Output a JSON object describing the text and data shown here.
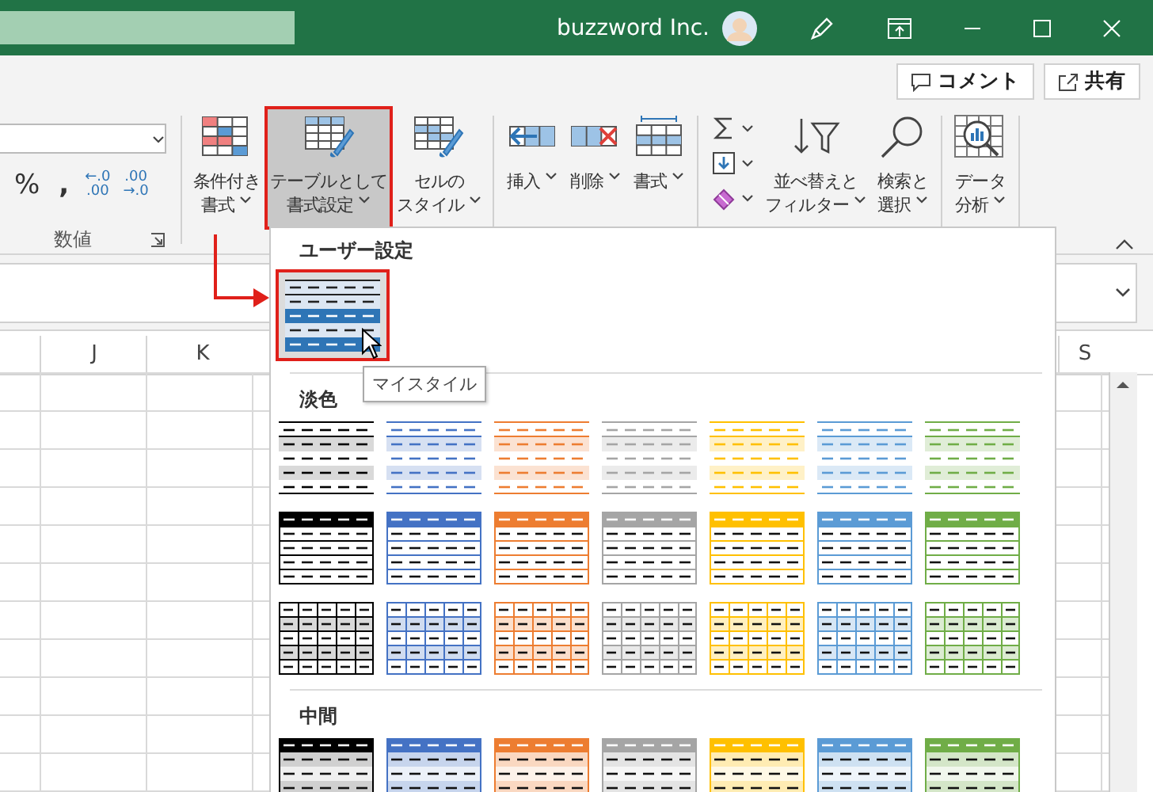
{
  "title_bar": {
    "account": "buzzword Inc."
  },
  "ribbon": {
    "comment_button": "コメント",
    "share_button": "共有",
    "number_group": {
      "label": "数値",
      "percent": "%",
      "comma": ",",
      "increase_decimal": [
        "←.0",
        ".00"
      ],
      "decrease_decimal": [
        ".00",
        "→.0"
      ]
    },
    "groups": [
      [
        {
          "kind": "large",
          "label": [
            "条件付き",
            "書式"
          ],
          "pressed": false
        },
        {
          "kind": "large",
          "label": [
            "テーブルとして",
            "書式設定"
          ],
          "pressed": true
        },
        {
          "kind": "large",
          "label": [
            "セルの",
            "スタイル"
          ],
          "pressed": false
        }
      ],
      [
        {
          "kind": "large",
          "label": [
            "挿入"
          ],
          "pressed": false
        },
        {
          "kind": "large",
          "label": [
            "削除"
          ],
          "pressed": false
        },
        {
          "kind": "large",
          "label": [
            "書式"
          ],
          "pressed": false
        }
      ],
      [
        {
          "kind": "stack"
        },
        {
          "kind": "large",
          "label": [
            "並べ替えと",
            "フィルター"
          ],
          "pressed": false
        },
        {
          "kind": "large",
          "label": [
            "検索と",
            "選択"
          ],
          "pressed": false
        }
      ],
      [
        {
          "kind": "large",
          "label": [
            "データ",
            "分析"
          ],
          "pressed": false
        }
      ]
    ]
  },
  "sheet": {
    "columns": [
      "J",
      "K",
      "S"
    ]
  },
  "gallery": {
    "tooltip": "マイスタイル",
    "sections": [
      {
        "title": "ユーザー設定",
        "styles": [
          {
            "kind": "custom",
            "color": "#2e75b6",
            "hovered": true
          }
        ]
      },
      {
        "title": "淡色",
        "styles": [
          {
            "kind": "light",
            "color": "#000000",
            "hovered": false
          },
          {
            "kind": "light",
            "color": "#4472c4",
            "hovered": false
          },
          {
            "kind": "light",
            "color": "#ed7d31",
            "hovered": false
          },
          {
            "kind": "light",
            "color": "#a5a5a5",
            "hovered": false
          },
          {
            "kind": "light",
            "color": "#ffc000",
            "hovered": false
          },
          {
            "kind": "light",
            "color": "#5b9bd5",
            "hovered": false
          },
          {
            "kind": "light",
            "color": "#70ad47",
            "hovered": false
          },
          {
            "kind": "header",
            "color": "#000000",
            "hovered": false
          },
          {
            "kind": "header",
            "color": "#4472c4",
            "hovered": false
          },
          {
            "kind": "header",
            "color": "#ed7d31",
            "hovered": false
          },
          {
            "kind": "header",
            "color": "#a5a5a5",
            "hovered": false
          },
          {
            "kind": "header",
            "color": "#ffc000",
            "hovered": false
          },
          {
            "kind": "header",
            "color": "#5b9bd5",
            "hovered": false
          },
          {
            "kind": "header",
            "color": "#70ad47",
            "hovered": false
          },
          {
            "kind": "grid",
            "color": "#000000",
            "hovered": false
          },
          {
            "kind": "grid",
            "color": "#4472c4",
            "hovered": false
          },
          {
            "kind": "grid",
            "color": "#ed7d31",
            "hovered": false
          },
          {
            "kind": "grid",
            "color": "#a5a5a5",
            "hovered": false
          },
          {
            "kind": "grid",
            "color": "#ffc000",
            "hovered": false
          },
          {
            "kind": "grid",
            "color": "#5b9bd5",
            "hovered": false
          },
          {
            "kind": "grid",
            "color": "#70ad47",
            "hovered": false
          }
        ]
      },
      {
        "title": "中間",
        "styles": [
          {
            "kind": "medium",
            "color": "#000000",
            "hovered": false
          },
          {
            "kind": "medium",
            "color": "#4472c4",
            "hovered": false
          },
          {
            "kind": "medium",
            "color": "#ed7d31",
            "hovered": false
          },
          {
            "kind": "medium",
            "color": "#a5a5a5",
            "hovered": false
          },
          {
            "kind": "medium",
            "color": "#ffc000",
            "hovered": false
          },
          {
            "kind": "medium",
            "color": "#5b9bd5",
            "hovered": false
          },
          {
            "kind": "medium",
            "color": "#70ad47",
            "hovered": false
          }
        ]
      }
    ]
  }
}
